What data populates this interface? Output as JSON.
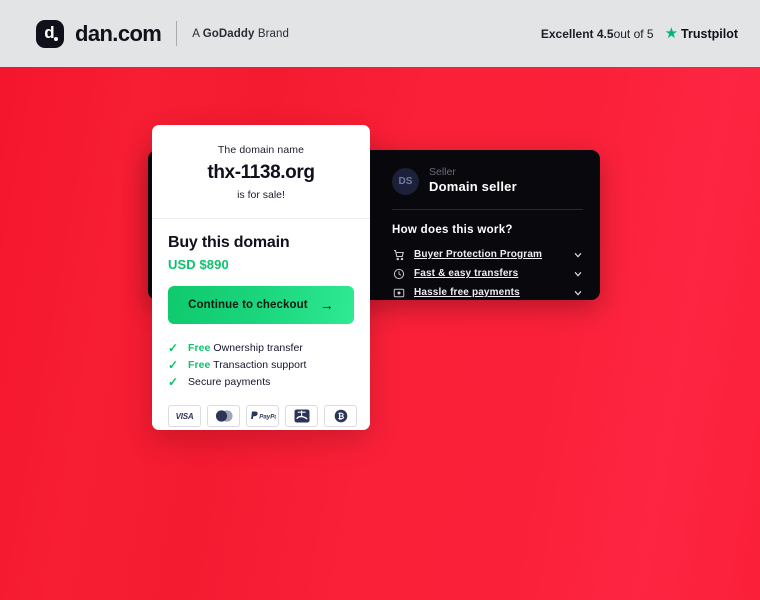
{
  "header": {
    "logo_icon": "dan-logo-icon",
    "brand": "dan.com",
    "brand_prefix": "A ",
    "brand_name": "GoDaddy",
    "brand_suffix": " Brand",
    "trust_rating_label": "Excellent 4.5",
    "trust_rating_suffix": " out of 5",
    "trust_star_icon": "star-icon",
    "trust_provider": "Trustpilot",
    "background": "#e3e4e6",
    "star_color": "#00b67a"
  },
  "buy_card": {
    "domain_prefix": "The domain name",
    "domain_name": "thx-1138.org",
    "domain_suffix": "is for sale!",
    "buy_title": "Buy this domain",
    "price": "USD $890",
    "checkout_label": "Continue to checkout",
    "checkout_arrow": "→",
    "price_color": "#0ec26d",
    "benefits": [
      {
        "free": "Free",
        "text": " Ownership transfer"
      },
      {
        "free": "Free",
        "text": " Transaction support"
      },
      {
        "free": "",
        "text": "Secure payments"
      }
    ],
    "payment_methods": [
      {
        "name": "visa",
        "label": "VISA"
      },
      {
        "name": "mastercard",
        "label": "Mastercard"
      },
      {
        "name": "paypal",
        "label": "PayPal"
      },
      {
        "name": "alipay",
        "label": "Alipay"
      },
      {
        "name": "bitcoin",
        "label": "Bitcoin"
      }
    ]
  },
  "seller_panel": {
    "avatar_initials": "DS",
    "seller_label": "Seller",
    "seller_name": "Domain seller",
    "how_title": "How does this work?",
    "items": [
      {
        "icon": "cart-icon",
        "label": "Buyer Protection Program"
      },
      {
        "icon": "clock-icon",
        "label": "Fast & easy transfers"
      },
      {
        "icon": "card-icon",
        "label": "Hassle free payments"
      }
    ],
    "background": "#09080d"
  },
  "page": {
    "background_color": "#f61f33"
  }
}
